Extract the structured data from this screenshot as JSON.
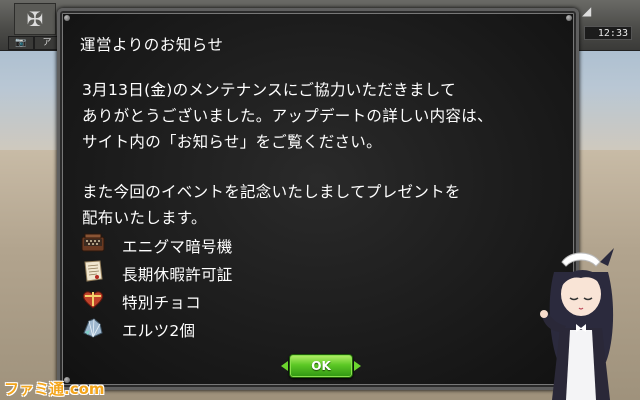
{
  "hud": {
    "emblem_glyph": "✠",
    "camera_glyph": "📷",
    "tab_label": "ア",
    "clock_time": "12:33"
  },
  "dialog": {
    "title": "運営よりのお知らせ",
    "paragraph1": [
      "3月13日(金)のメンテナンスにご協力いただきまして",
      "ありがとうございました。アップデートの詳しい内容は、",
      "サイト内の「お知らせ」をご覧ください。"
    ],
    "paragraph2": [
      "また今回のイベントを記念いたしましてプレゼントを",
      "配布いたします。"
    ],
    "rewards": [
      {
        "label": "エニグマ暗号機",
        "icon": "enigma-machine-icon"
      },
      {
        "label": "長期休暇許可証",
        "icon": "scroll-document-icon"
      },
      {
        "label": "特別チョコ",
        "icon": "heart-chocolate-icon"
      },
      {
        "label": "エルツ2個",
        "icon": "crystal-ore-icon"
      }
    ],
    "ok_label": "OK"
  },
  "watermark": "ファミ通.com",
  "colors": {
    "dialog_bg": "#1b1b1b",
    "dialog_border": "#5f5f5f",
    "text": "#ffffff",
    "ok_green": "#5cc825",
    "watermark": "#f3a51b"
  }
}
